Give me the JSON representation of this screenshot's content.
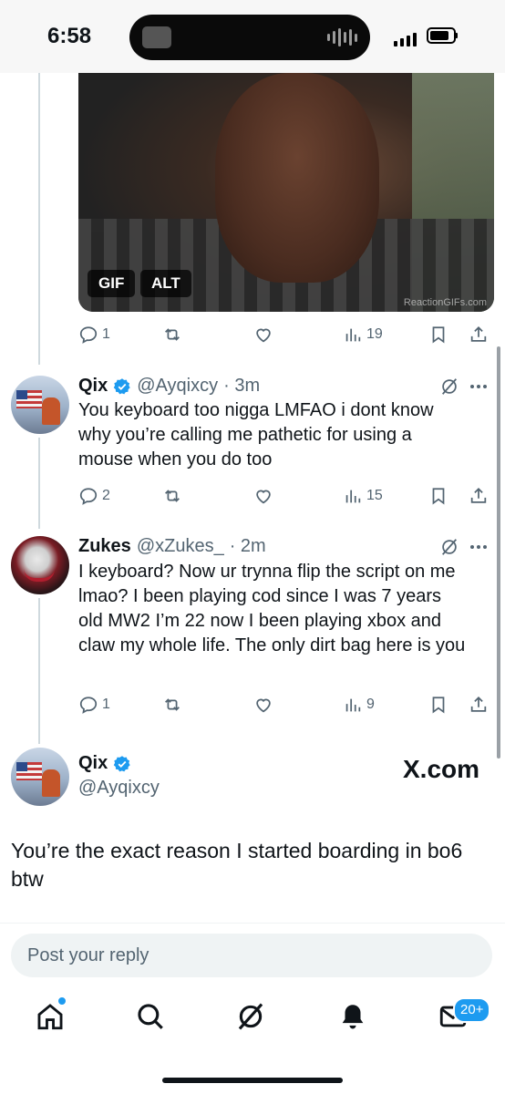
{
  "status_bar": {
    "time": "6:58"
  },
  "gif_card": {
    "gif_badge": "GIF",
    "alt_badge": "ALT",
    "watermark": "ReactionGIFs.com"
  },
  "gif_actions": {
    "replies": "1",
    "views": "19"
  },
  "tweets": [
    {
      "name": "Qix",
      "handle": "@Ayqixcy",
      "time": "· 3m",
      "text": "You keyboard too nigga LMFAO i dont know why you’re calling me pathetic for using a mouse when you do too",
      "replies": "2",
      "views": "15"
    },
    {
      "name": "Zukes",
      "handle": "@xZukes_",
      "time": "· 2m",
      "text": "I keyboard? Now  ur trynna flip  the script on me lmao? I been playing cod since I was 7 years old MW2 I’m 22 now I been playing xbox and claw my whole life. The only dirt bag here is you",
      "replies": "1",
      "views": "9"
    }
  ],
  "main_tweet": {
    "name": "Qix",
    "handle": "@Ayqixcy",
    "watermark": "X.com",
    "text": "You’re the exact reason I started boarding in bo6 btw"
  },
  "reply_box": {
    "placeholder": "Post your reply"
  },
  "tab_bar": {
    "messages_badge": "20+"
  },
  "colors": {
    "accent": "#1d9bf0",
    "secondary_text": "#536471",
    "primary_text": "#0f1419"
  }
}
